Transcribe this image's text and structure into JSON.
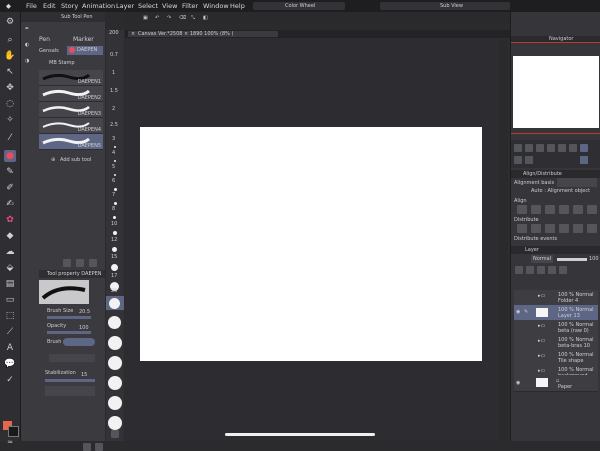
{
  "menubar": {
    "items": [
      "File",
      "Edit",
      "Story",
      "Animation",
      "Layer",
      "Select",
      "View",
      "Filter",
      "Window",
      "Help"
    ],
    "color_wheel_tab": "Color Wheel",
    "sub_view_tab": "Sub View"
  },
  "canvas": {
    "title": "Canvas Ver.*2508 × 1890 100% (8% )"
  },
  "subtool": {
    "tab_group": "Sub Tool Pen",
    "tabs": [
      "Pen",
      "Marker"
    ],
    "selected_short": "DAEPEN",
    "groups": [
      "Gensals",
      "MB Stamp"
    ],
    "brushes": [
      "DAEPEN1",
      "DAEPEN2",
      "DAEPEN3",
      "DAEPEN4",
      "DAEPEN5"
    ],
    "add_label": "Add sub tool"
  },
  "tool_property": {
    "header": "Tool property DAEPEN",
    "brush_size_label": "Brush Size",
    "brush_size_value": "20.5",
    "opacity_label": "Opacity",
    "opacity_value": "100",
    "brush_shape_label": "Brush shape",
    "stabilization_label": "Stabilization",
    "stabilization_value": "15"
  },
  "size_ruler": [
    "200",
    "0.7",
    "1",
    "1.5",
    "2",
    "2.5",
    "3",
    "4",
    "5",
    "6",
    "7",
    "8",
    "10",
    "12",
    "15",
    "17",
    "20",
    "25",
    "30",
    "40",
    "50",
    "60",
    "70",
    "80",
    "100"
  ],
  "navigator": {
    "title": "Navigator"
  },
  "align": {
    "title": "Align/Distribute",
    "basis_label": "Alignment basis",
    "basis_value": "Auto : Alignment object",
    "align_label": "Align",
    "distribute_label": "Distribute",
    "distribute_events_label": "Distribute events"
  },
  "layers": {
    "title": "Layer",
    "blend_mode": "Normal",
    "opacity": "100",
    "rows": [
      {
        "mode": "100 % Normal",
        "name": "Folder 4"
      },
      {
        "mode": "100 % Normal",
        "name": "Layer 13"
      },
      {
        "mode": "100 % Normal",
        "name": "beta (raw 0)"
      },
      {
        "mode": "100 % Normal",
        "name": "beta-bras 10"
      },
      {
        "mode": "100 % Normal",
        "name": "Tile shape"
      },
      {
        "mode": "100 % Normal",
        "name": "background ..."
      },
      {
        "mode": "",
        "name": "Paper"
      }
    ]
  },
  "colors": {
    "accent": "#5d6685",
    "canvas_bg": "#2d2c30",
    "main_color": "#e8674a",
    "sub_color": "#1a1a1a"
  }
}
